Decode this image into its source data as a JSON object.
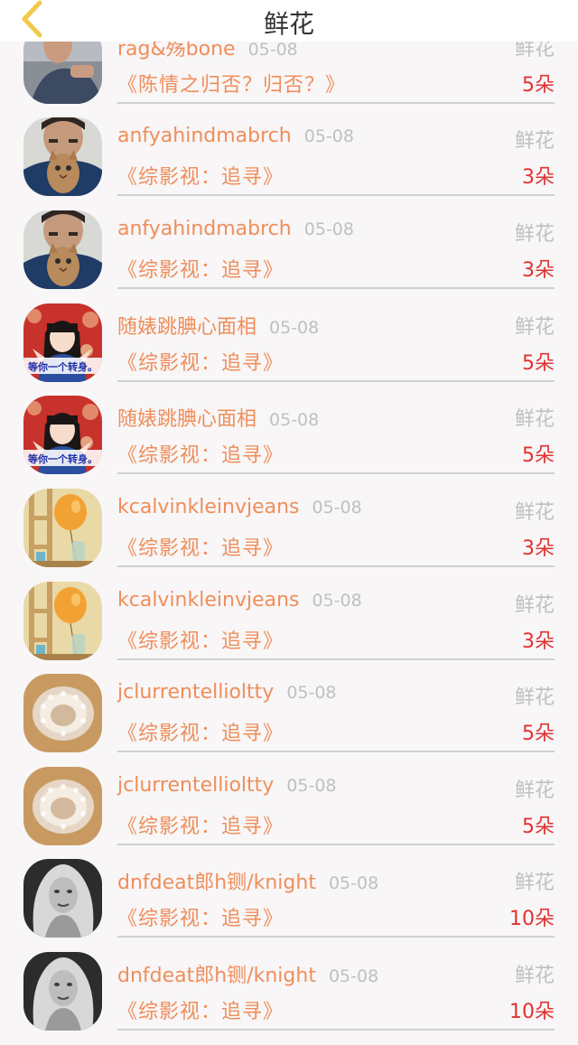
{
  "header": {
    "title": "鲜花",
    "back_icon": "chevron-left-icon",
    "back_color": "#f2c94c"
  },
  "records": [
    {
      "name": "rag&殇bone",
      "date": "05-08",
      "gift_type": "鲜花",
      "work": "《陈情之归否？归否？》",
      "count": "5朵",
      "avatar": "avatar-man-photo"
    },
    {
      "name": "anfyahindmabrch",
      "date": "05-08",
      "gift_type": "鲜花",
      "work": "《综影视：追寻》",
      "count": "3朵",
      "avatar": "avatar-man-with-cat"
    },
    {
      "name": "anfyahindmabrch",
      "date": "05-08",
      "gift_type": "鲜花",
      "work": "《综影视：追寻》",
      "count": "3朵",
      "avatar": "avatar-man-with-cat"
    },
    {
      "name": "随婊跳腆心面相",
      "date": "05-08",
      "gift_type": "鲜花",
      "work": "《综影视：追寻》",
      "count": "5朵",
      "avatar": "avatar-girl-illustration",
      "avatar_text": "等你一个转身。"
    },
    {
      "name": "随婊跳腆心面相",
      "date": "05-08",
      "gift_type": "鲜花",
      "work": "《综影视：追寻》",
      "count": "5朵",
      "avatar": "avatar-girl-illustration",
      "avatar_text": "等你一个转身。"
    },
    {
      "name": "kcalvinkleinvjeans",
      "date": "05-08",
      "gift_type": "鲜花",
      "work": "《综影视：追寻》",
      "count": "3朵",
      "avatar": "avatar-balloon-shelf"
    },
    {
      "name": "kcalvinkleinvjeans",
      "date": "05-08",
      "gift_type": "鲜花",
      "work": "《综影视：追寻》",
      "count": "3朵",
      "avatar": "avatar-balloon-shelf"
    },
    {
      "name": "jclurrentellioltty",
      "date": "05-08",
      "gift_type": "鲜花",
      "work": "《综影视：追寻》",
      "count": "5朵",
      "avatar": "avatar-crystal-ring"
    },
    {
      "name": "jclurrentellioltty",
      "date": "05-08",
      "gift_type": "鲜花",
      "work": "《综影视：追寻》",
      "count": "5朵",
      "avatar": "avatar-crystal-ring"
    },
    {
      "name": "dnfdeat郎h铡/knight",
      "date": "05-08",
      "gift_type": "鲜花",
      "work": "《综影视：追寻》",
      "count": "10朵",
      "avatar": "avatar-woman-bw"
    },
    {
      "name": "dnfdeat郎h铡/knight",
      "date": "05-08",
      "gift_type": "鲜花",
      "work": "《综影视：追寻》",
      "count": "10朵",
      "avatar": "avatar-woman-bw"
    }
  ]
}
